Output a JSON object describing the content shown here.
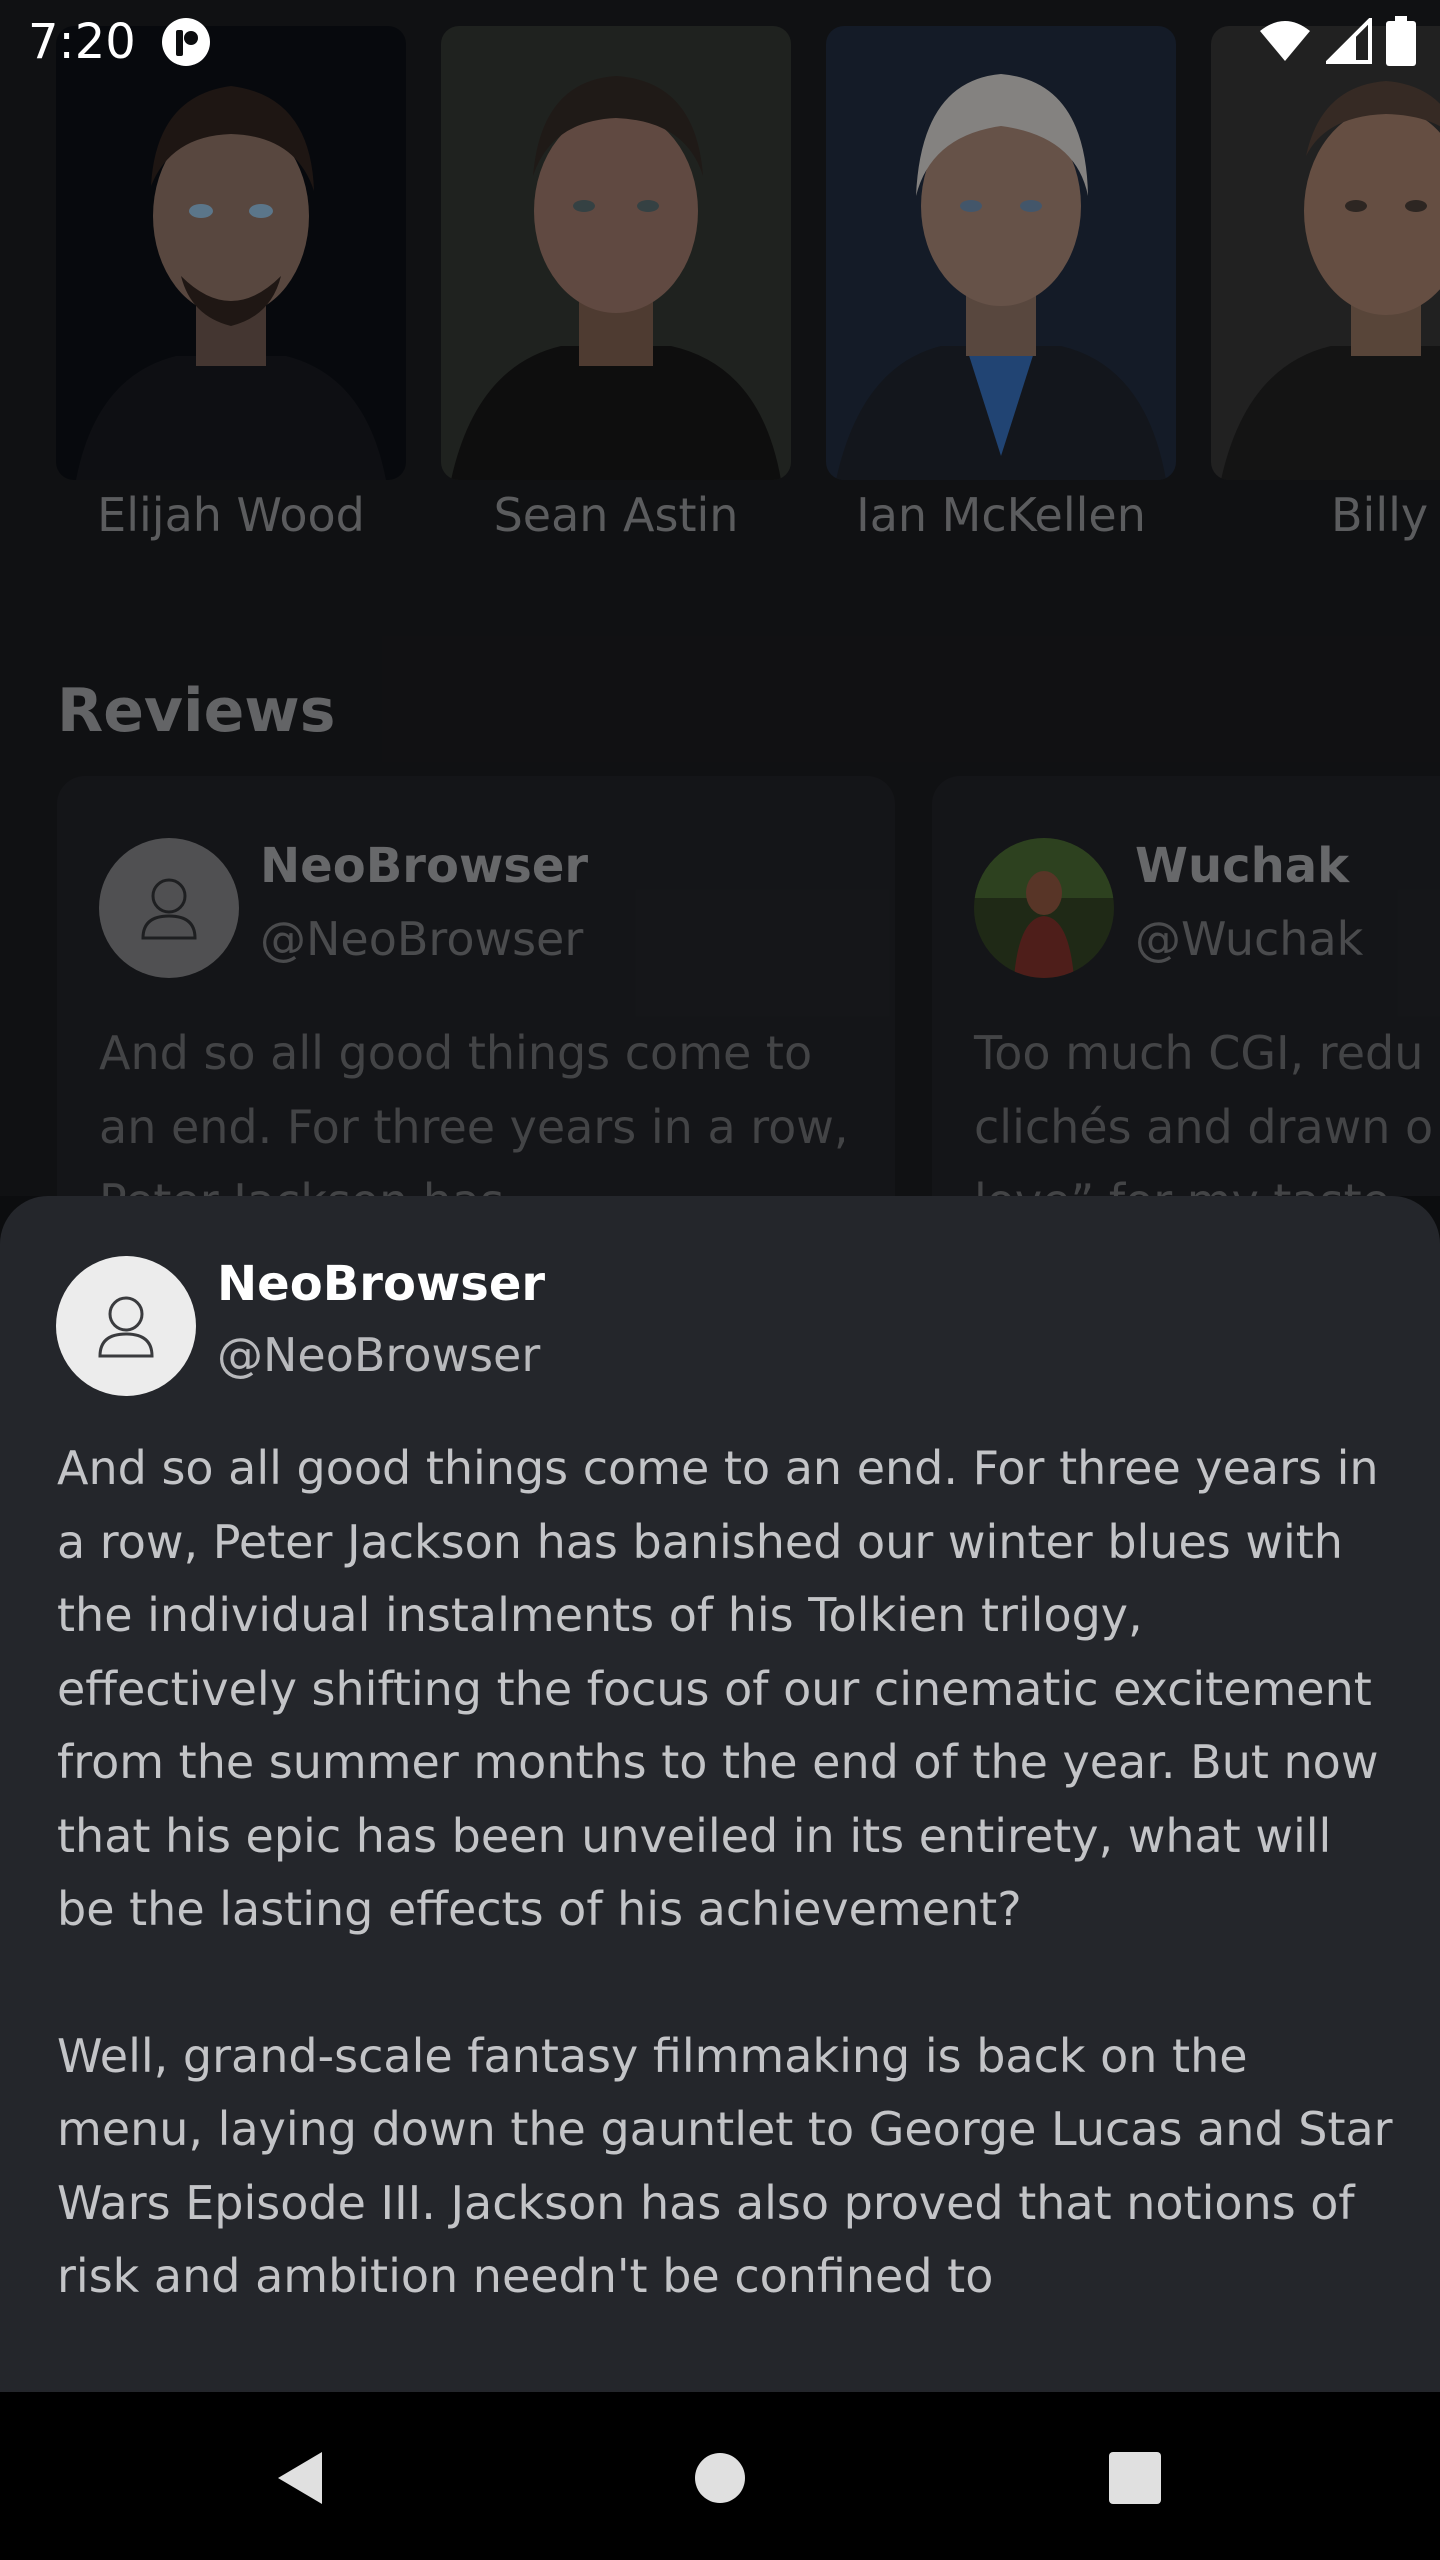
{
  "status_bar": {
    "time": "7:20",
    "icons": [
      "app-notification-icon",
      "wifi-icon",
      "cellular-signal-icon",
      "battery-icon"
    ]
  },
  "cast": [
    {
      "name": "Elijah Wood"
    },
    {
      "name": "Sean Astin"
    },
    {
      "name": "Ian McKellen"
    },
    {
      "name": "Billy Bo"
    }
  ],
  "reviews_section": {
    "title": "Reviews",
    "cards": [
      {
        "author": "NeoBrowser",
        "handle": "@NeoBrowser",
        "excerpt": "And so all good things come to an end. For three years in a row, Peter Jackson has"
      },
      {
        "author": "Wuchak",
        "handle": "@Wuchak",
        "excerpt": "Too much CGI, redu clichés and drawn o of love” for my taste"
      }
    ]
  },
  "sheet": {
    "author": "NeoBrowser",
    "handle": "@NeoBrowser",
    "paragraphs": [
      "And so all good things come to an end. For three years in a row, Peter Jackson has banished our winter blues with the individual instalments of his Tolkien trilogy, effectively shifting the focus of our cinematic excitement from the summer months to the end of the year. But now that his epic has been unveiled in its entirety, what will be the lasting effects of his achievement?",
      "Well, grand-scale fantasy filmmaking is back on the menu, laying down the gauntlet to George Lucas and Star Wars Episode III. Jackson has also proved that notions of risk and ambition needn't be confined to"
    ]
  },
  "nav_bar": {
    "buttons": [
      "back-icon",
      "home-icon",
      "recents-icon"
    ]
  },
  "colors": {
    "background": "#17181b",
    "sheet": "#24262b",
    "card": "#1d1e22",
    "text_primary": "#ffffff",
    "text_secondary": "#b8b9bc"
  }
}
